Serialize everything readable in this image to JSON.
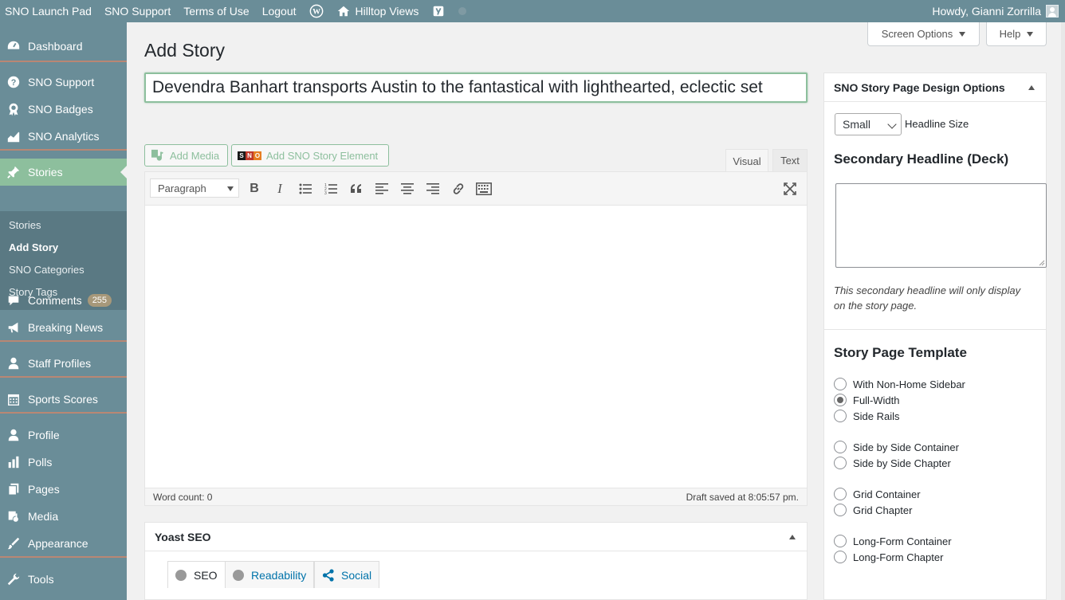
{
  "admin_bar": {
    "items": [
      "SNO Launch Pad",
      "SNO Support",
      "Terms of Use",
      "Logout"
    ],
    "site_name": "Hilltop Views",
    "greeting": "Howdy, Gianni Zorrilla"
  },
  "sidebar": {
    "items": [
      {
        "label": "Dashboard",
        "icon": "dashboard-icon"
      },
      {
        "label": "SNO Support",
        "icon": "help-icon"
      },
      {
        "label": "SNO Badges",
        "icon": "badge-icon"
      },
      {
        "label": "SNO Analytics",
        "icon": "analytics-icon"
      },
      {
        "label": "Stories",
        "icon": "pin-icon"
      },
      {
        "label": "Comments",
        "icon": "comment-icon",
        "badge": "255"
      },
      {
        "label": "Breaking News",
        "icon": "megaphone-icon"
      },
      {
        "label": "Staff Profiles",
        "icon": "user-icon"
      },
      {
        "label": "Sports Scores",
        "icon": "calendar-icon"
      },
      {
        "label": "Profile",
        "icon": "user-icon"
      },
      {
        "label": "Polls",
        "icon": "bar-chart-icon"
      },
      {
        "label": "Pages",
        "icon": "pages-icon"
      },
      {
        "label": "Media",
        "icon": "media-icon"
      },
      {
        "label": "Appearance",
        "icon": "brush-icon"
      },
      {
        "label": "Tools",
        "icon": "wrench-icon"
      }
    ],
    "submenu": [
      "Stories",
      "Add Story",
      "SNO Categories",
      "Story Tags"
    ]
  },
  "header": {
    "screen_options": "Screen Options",
    "help": "Help",
    "page_title": "Add Story"
  },
  "editor": {
    "title_value": "Devendra Banhart transports Austin to the fantastical with lighthearted, eclectic set",
    "add_media": "Add Media",
    "add_sno_element": "Add SNO Story Element",
    "tab_visual": "Visual",
    "tab_text": "Text",
    "format": "Paragraph",
    "word_count": "Word count: 0",
    "draft_saved": "Draft saved at 8:05:57 pm."
  },
  "yoast": {
    "title": "Yoast SEO",
    "tabs": [
      "SEO",
      "Readability",
      "Social"
    ]
  },
  "design_options": {
    "title": "SNO Story Page Design Options",
    "headline_size_value": "Small",
    "headline_size_label": "Headline Size",
    "deck_title": "Secondary Headline (Deck)",
    "deck_help": "This secondary headline will only display on the story page.",
    "template_title": "Story Page Template",
    "templates": [
      {
        "label": "With Non-Home Sidebar",
        "checked": false
      },
      {
        "label": "Full-Width",
        "checked": true
      },
      {
        "label": "Side Rails",
        "checked": false
      },
      {
        "label": "Side by Side Container",
        "checked": false
      },
      {
        "label": "Side by Side Chapter",
        "checked": false
      },
      {
        "label": "Grid Container",
        "checked": false
      },
      {
        "label": "Grid Chapter",
        "checked": false
      },
      {
        "label": "Long-Form Container",
        "checked": false
      },
      {
        "label": "Long-Form Chapter",
        "checked": false
      }
    ]
  },
  "colors": {
    "admin_bg": "#6a8d98",
    "active_green": "#8dbf9d",
    "separator": "#b98774",
    "link_blue": "#0073aa"
  }
}
